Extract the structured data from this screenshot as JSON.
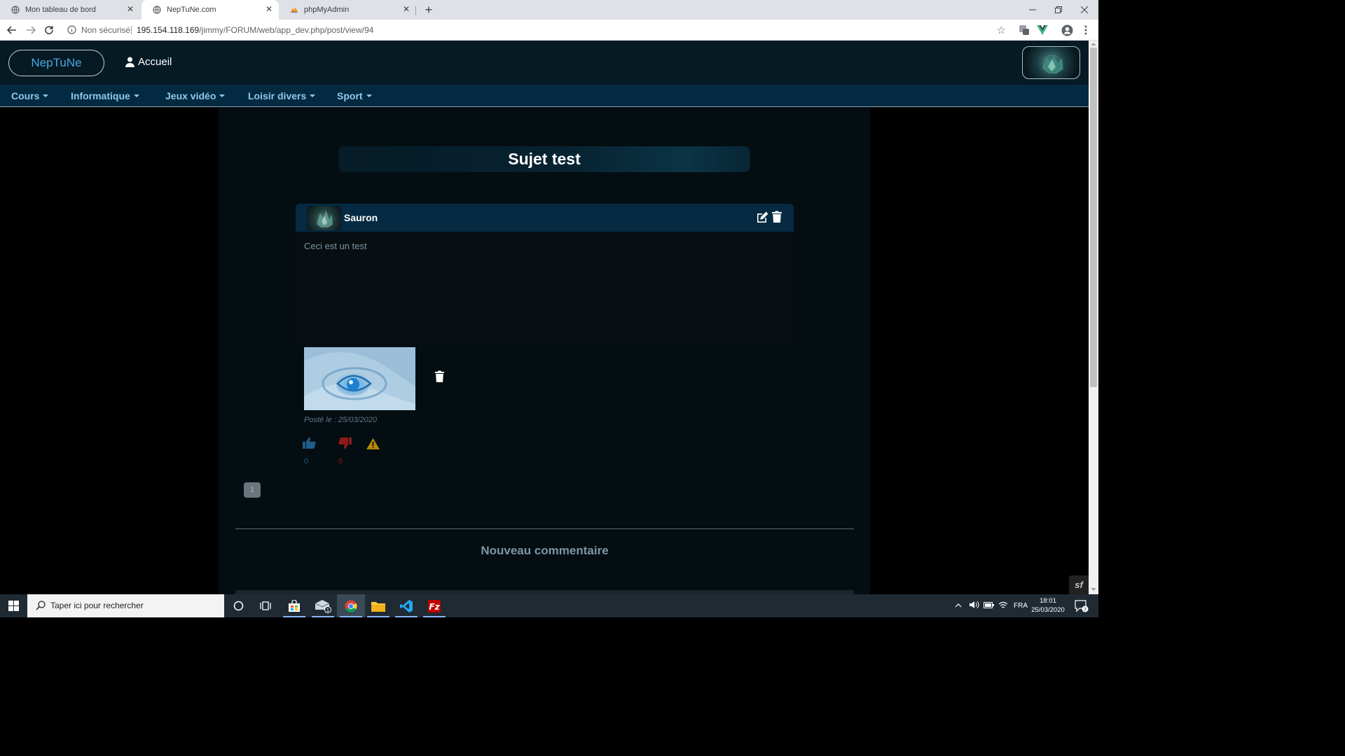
{
  "browser": {
    "tabs": [
      {
        "title": "Mon tableau de bord",
        "icon": "globe-icon",
        "active": false
      },
      {
        "title": "NepTuNe.com",
        "icon": "globe-icon",
        "active": true
      },
      {
        "title": "phpMyAdmin",
        "icon": "phpmyadmin-icon",
        "active": false
      }
    ],
    "new_tab_label": "+",
    "security_label": "Non sécurisé",
    "url_host": "195.154.118.169",
    "url_path": "/jimmy/FORUM/web/app_dev.php/post/view/94"
  },
  "site": {
    "brand": "NepTuNe",
    "home_label": "Accueil",
    "nav": [
      {
        "label": "Cours"
      },
      {
        "label": "Informatique"
      },
      {
        "label": "Jeux vidéo"
      },
      {
        "label": "Loisir divers"
      },
      {
        "label": "Sport"
      }
    ]
  },
  "topic": {
    "title": "Sujet test"
  },
  "post": {
    "author": "Sauron",
    "body": "Ceci est un test",
    "date_label": "Posté le : 25/03/2020",
    "upvotes": "0",
    "downvotes": "0"
  },
  "pagination": {
    "current_page": "1"
  },
  "comments": {
    "new_comment_title": "Nouveau commentaire"
  },
  "taskbar": {
    "search_placeholder": "Taper ici pour rechercher",
    "language": "FRA",
    "time": "18:01",
    "date": "25/03/2020",
    "notification_count": "7",
    "mail_badge": "1"
  },
  "colors": {
    "header_bg": "#061a24",
    "navbar_bg": "#042a42",
    "brand_blue": "#4aa6e0",
    "vote_up": "#1d5d8e",
    "vote_down": "#8b1b1b",
    "warning": "#b8860b"
  }
}
